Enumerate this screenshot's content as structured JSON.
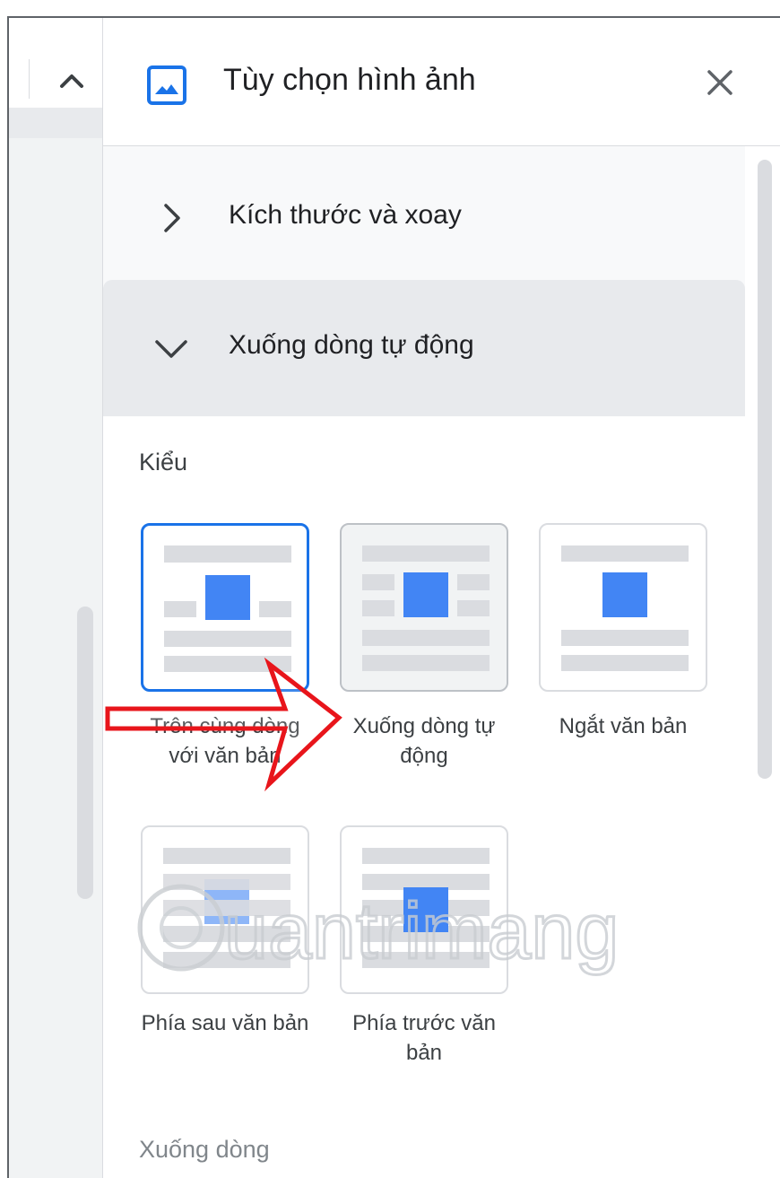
{
  "panel": {
    "title": "Tùy chọn hình ảnh",
    "header_icon": "image-icon",
    "close_icon": "close-icon"
  },
  "sections": {
    "size_rotation": {
      "label": "Kích thước và xoay",
      "expanded": false,
      "icon": "chevron-right-icon"
    },
    "text_wrapping": {
      "label": "Xuống dòng tự động",
      "expanded": true,
      "icon": "chevron-down-icon"
    }
  },
  "wrapping": {
    "style_heading": "Kiểu",
    "options": [
      {
        "label": "Trên cùng dòng với văn bản",
        "state": "selected"
      },
      {
        "label": "Xuống dòng tự động",
        "state": "hover"
      },
      {
        "label": "Ngắt văn bản",
        "state": "default"
      },
      {
        "label": "Phía sau văn bản",
        "state": "default"
      },
      {
        "label": "Phía trước văn bản",
        "state": "default"
      }
    ],
    "next_heading": "Xuống dòng"
  },
  "left_toolbar": {
    "icon": "chevron-up-icon"
  },
  "watermark": {
    "text": "uantrimang"
  },
  "colors": {
    "accent": "#1a73e8",
    "image_block": "#4285f4",
    "text_line": "#dadce0",
    "annotation_arrow": "#e8151b"
  }
}
